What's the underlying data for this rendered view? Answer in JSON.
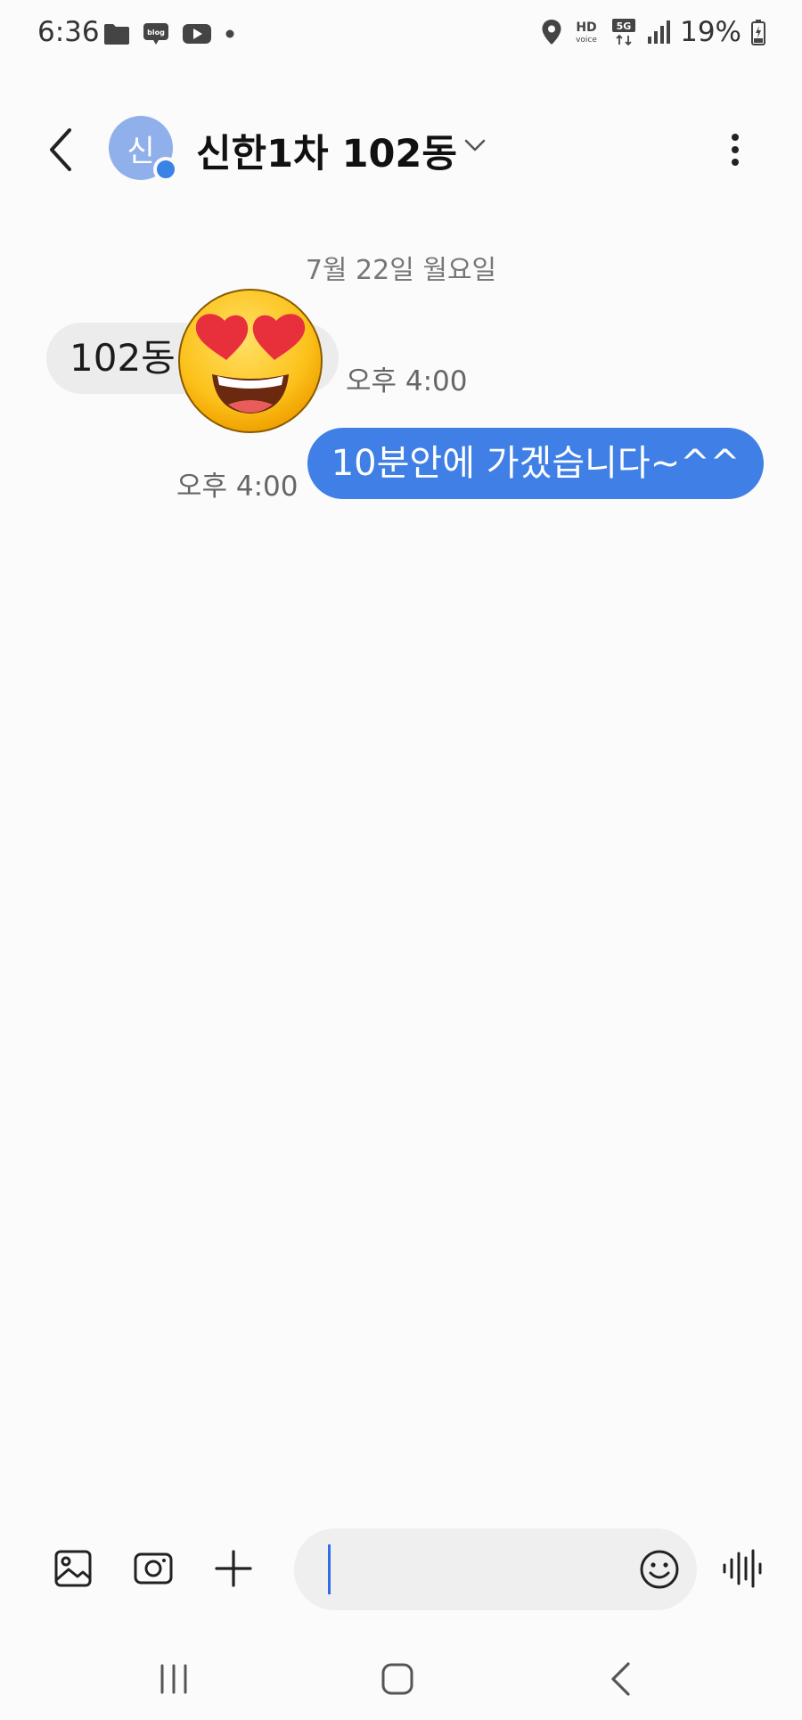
{
  "status_bar": {
    "time": "6:36",
    "left_icons": [
      "folder-icon",
      "blog-icon",
      "youtube-icon",
      "dot-icon"
    ],
    "right_icons": [
      "location-icon",
      "hd-voice-icon",
      "5g-icon",
      "signal-icon",
      "battery-charging-icon"
    ],
    "blog_label": "blog",
    "hd_label": "HD",
    "voice_label": "voice",
    "network_label": "5G",
    "battery": "19%"
  },
  "header": {
    "avatar_initial": "신",
    "contact_name": "신한1차 102동"
  },
  "conversation": {
    "date_divider": "7월 22일 월요일",
    "messages": [
      {
        "direction": "incoming",
        "text": "102동",
        "time": "오후 4:00",
        "emoji": "smiling-face-with-heart-eyes"
      },
      {
        "direction": "outgoing",
        "text": "10분안에 가겠습니다~^^",
        "time": "오후 4:00"
      }
    ]
  },
  "composer": {
    "input_value": "",
    "icons": [
      "gallery-icon",
      "camera-icon",
      "plus-icon",
      "emoji-icon",
      "voice-wave-icon"
    ]
  },
  "colors": {
    "accent": "#3f7fe6",
    "background": "#fbfbfb",
    "incoming_bubble": "#ececec",
    "avatar": "#8fb0ea"
  }
}
